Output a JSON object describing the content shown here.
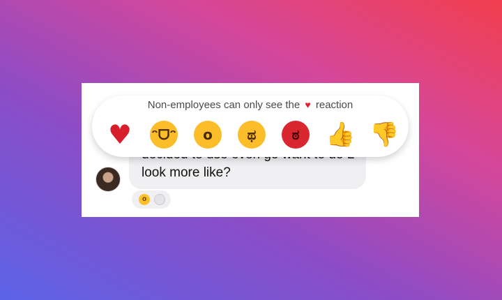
{
  "reaction_tray": {
    "note_before": "Non-employees can only see the",
    "note_heart": "♥",
    "note_after": "reaction",
    "reactions": [
      {
        "name": "heart",
        "glyph": "♥"
      },
      {
        "name": "laughing-crying",
        "glyph": "ᵔᗜᵔ"
      },
      {
        "name": "wow",
        "glyph": "o"
      },
      {
        "name": "crying",
        "glyph": "ಥ"
      },
      {
        "name": "angry",
        "glyph": "ಠ"
      },
      {
        "name": "thumbs-up",
        "glyph": "👍"
      },
      {
        "name": "thumbs-down",
        "glyph": "👎"
      }
    ]
  },
  "message": {
    "text": "decided to use even go want to do L look more like?",
    "received_reactions": [
      {
        "name": "wow",
        "glyph": "o"
      },
      {
        "name": "user-placeholder",
        "glyph": ""
      }
    ]
  },
  "colors": {
    "heart": "#d61f2b",
    "emoji_yellow": "#fbbd2a",
    "angry_red": "#d9272f",
    "bubble": "#f0f0f3"
  }
}
